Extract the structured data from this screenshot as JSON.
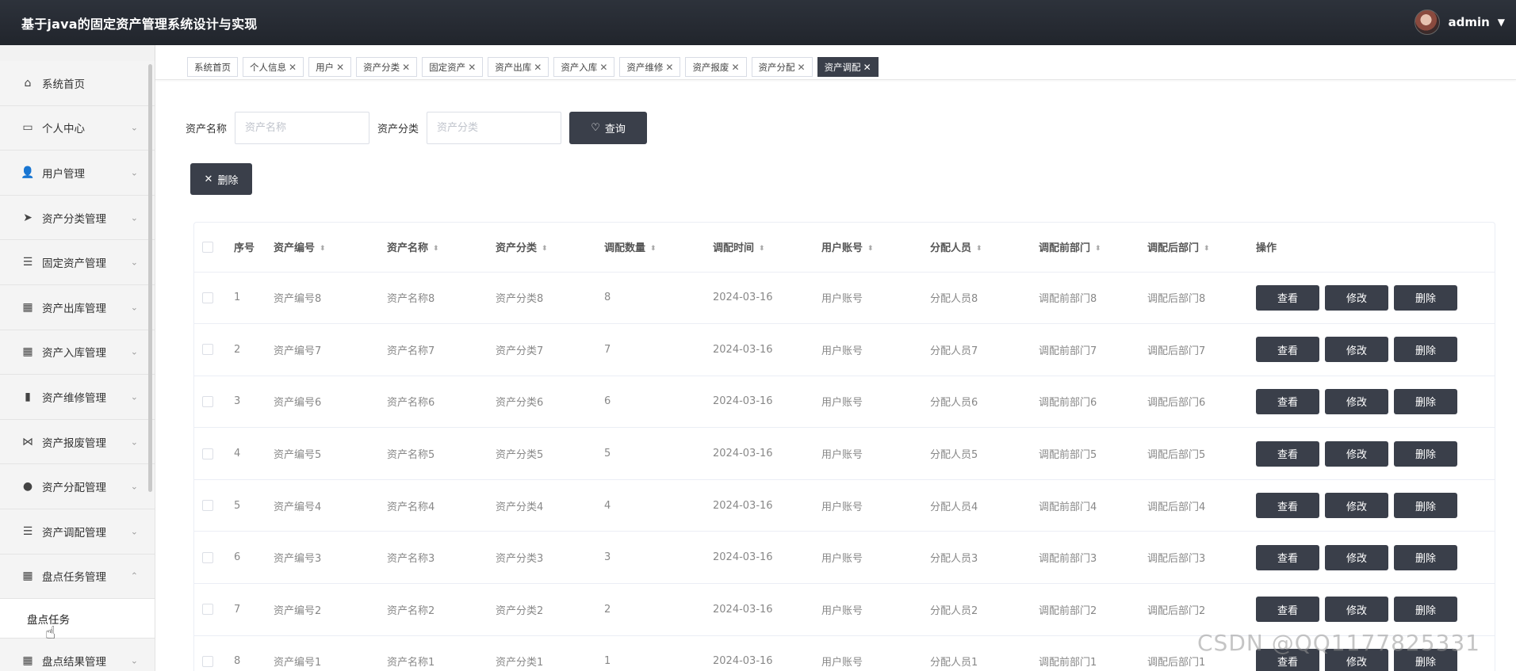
{
  "header": {
    "app_title": "基于java的固定资产管理系统设计与实现",
    "username": "admin"
  },
  "sidebar": {
    "items": [
      {
        "label": "系统首页",
        "icon": "home-icon",
        "arrow": ""
      },
      {
        "label": "个人中心",
        "icon": "window-icon",
        "arrow": "⌄"
      },
      {
        "label": "用户管理",
        "icon": "user-icon",
        "arrow": "⌄"
      },
      {
        "label": "资产分类管理",
        "icon": "paper-plane-icon",
        "arrow": "⌄"
      },
      {
        "label": "固定资产管理",
        "icon": "list-icon",
        "arrow": "⌄"
      },
      {
        "label": "资产出库管理",
        "icon": "grid-icon",
        "arrow": "⌄"
      },
      {
        "label": "资产入库管理",
        "icon": "grid9-icon",
        "arrow": "⌄"
      },
      {
        "label": "资产维修管理",
        "icon": "bar-chart-icon",
        "arrow": "⌄"
      },
      {
        "label": "资产报废管理",
        "icon": "bow-icon",
        "arrow": "⌄"
      },
      {
        "label": "资产分配管理",
        "icon": "location-icon",
        "arrow": "⌄"
      },
      {
        "label": "资产调配管理",
        "icon": "list-icon",
        "arrow": "⌄"
      },
      {
        "label": "盘点任务管理",
        "icon": "grid-icon",
        "arrow": "⌃"
      }
    ],
    "submenu": {
      "label": "盘点任务"
    },
    "last_item": {
      "label": "盘点结果管理",
      "icon": "grid-icon",
      "arrow": "⌄"
    }
  },
  "tabs": [
    {
      "label": "系统首页",
      "closable": false,
      "active": false
    },
    {
      "label": "个人信息",
      "closable": true,
      "active": false
    },
    {
      "label": "用户",
      "closable": true,
      "active": false
    },
    {
      "label": "资产分类",
      "closable": true,
      "active": false
    },
    {
      "label": "固定资产",
      "closable": true,
      "active": false
    },
    {
      "label": "资产出库",
      "closable": true,
      "active": false
    },
    {
      "label": "资产入库",
      "closable": true,
      "active": false
    },
    {
      "label": "资产维修",
      "closable": true,
      "active": false
    },
    {
      "label": "资产报废",
      "closable": true,
      "active": false
    },
    {
      "label": "资产分配",
      "closable": true,
      "active": false
    },
    {
      "label": "资产调配",
      "closable": true,
      "active": true
    }
  ],
  "search": {
    "name_label": "资产名称",
    "name_placeholder": "资产名称",
    "category_label": "资产分类",
    "category_placeholder": "资产分类",
    "query_button": "查询",
    "delete_button": "删除"
  },
  "table": {
    "columns": [
      "序号",
      "资产编号",
      "资产名称",
      "资产分类",
      "调配数量",
      "调配时间",
      "用户账号",
      "分配人员",
      "调配前部门",
      "调配后部门",
      "操作"
    ],
    "sortable": [
      false,
      true,
      true,
      true,
      true,
      true,
      true,
      true,
      true,
      true,
      false
    ],
    "rows": [
      {
        "no": "1",
        "code": "资产编号8",
        "name": "资产名称8",
        "category": "资产分类8",
        "qty": "8",
        "time": "2024-03-16",
        "account": "用户账号",
        "person": "分配人员8",
        "dept_before": "调配前部门8",
        "dept_after": "调配后部门8"
      },
      {
        "no": "2",
        "code": "资产编号7",
        "name": "资产名称7",
        "category": "资产分类7",
        "qty": "7",
        "time": "2024-03-16",
        "account": "用户账号",
        "person": "分配人员7",
        "dept_before": "调配前部门7",
        "dept_after": "调配后部门7"
      },
      {
        "no": "3",
        "code": "资产编号6",
        "name": "资产名称6",
        "category": "资产分类6",
        "qty": "6",
        "time": "2024-03-16",
        "account": "用户账号",
        "person": "分配人员6",
        "dept_before": "调配前部门6",
        "dept_after": "调配后部门6"
      },
      {
        "no": "4",
        "code": "资产编号5",
        "name": "资产名称5",
        "category": "资产分类5",
        "qty": "5",
        "time": "2024-03-16",
        "account": "用户账号",
        "person": "分配人员5",
        "dept_before": "调配前部门5",
        "dept_after": "调配后部门5"
      },
      {
        "no": "5",
        "code": "资产编号4",
        "name": "资产名称4",
        "category": "资产分类4",
        "qty": "4",
        "time": "2024-03-16",
        "account": "用户账号",
        "person": "分配人员4",
        "dept_before": "调配前部门4",
        "dept_after": "调配后部门4"
      },
      {
        "no": "6",
        "code": "资产编号3",
        "name": "资产名称3",
        "category": "资产分类3",
        "qty": "3",
        "time": "2024-03-16",
        "account": "用户账号",
        "person": "分配人员3",
        "dept_before": "调配前部门3",
        "dept_after": "调配后部门3"
      },
      {
        "no": "7",
        "code": "资产编号2",
        "name": "资产名称2",
        "category": "资产分类2",
        "qty": "2",
        "time": "2024-03-16",
        "account": "用户账号",
        "person": "分配人员2",
        "dept_before": "调配前部门2",
        "dept_after": "调配后部门2"
      },
      {
        "no": "8",
        "code": "资产编号1",
        "name": "资产名称1",
        "category": "资产分类1",
        "qty": "1",
        "time": "2024-03-16",
        "account": "用户账号",
        "person": "分配人员1",
        "dept_before": "调配前部门1",
        "dept_after": "调配后部门1"
      }
    ],
    "actions": {
      "view": "查看",
      "edit": "修改",
      "delete": "删除"
    }
  },
  "watermark": "CSDN @QQ1177825331",
  "colors": {
    "header_bg": "#2d323b",
    "button_dark": "#3a3f4a",
    "sidebar_bg": "#f4f4f4"
  }
}
